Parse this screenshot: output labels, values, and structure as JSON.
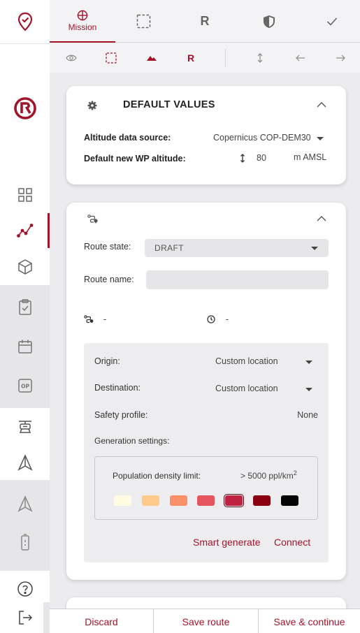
{
  "colors": {
    "accent": "#a3142a",
    "panel": "#ededef",
    "rail_gray": "#e6e6e8"
  },
  "rail": {
    "items": [
      {
        "icon": "location-check-icon"
      },
      {
        "icon": "brand-logo-icon"
      },
      {
        "icon": "grid-icon"
      },
      {
        "icon": "route-icon",
        "active": true
      },
      {
        "icon": "cube-icon"
      },
      {
        "icon": "clipboard-check-icon"
      },
      {
        "icon": "calendar-icon"
      },
      {
        "icon": "op-badge-icon"
      },
      {
        "icon": "drone-icon"
      },
      {
        "icon": "navigation-icon"
      },
      {
        "icon": "navigation-icon"
      },
      {
        "icon": "battery-icon"
      },
      {
        "icon": "help-icon"
      },
      {
        "icon": "logout-icon"
      }
    ]
  },
  "tabs": {
    "mission_label": "Mission",
    "mission_icon": "crosshair-icon",
    "area_icon": "dashed-square-icon",
    "r_glyph": "R",
    "shield_icon": "shield-icon",
    "check_icon": "check-icon"
  },
  "toolbar": {
    "r_glyph": "R",
    "icons": [
      "eye-icon",
      "dashed-square-icon",
      "terrain-icon",
      "r-icon",
      "vertical-arrows-icon",
      "arrow-left-icon",
      "arrow-right-icon"
    ]
  },
  "defaults": {
    "title": "DEFAULT VALUES",
    "altitude_source_label": "Altitude data source:",
    "altitude_source_value": "Copernicus COP-DEM30",
    "wp_altitude_label": "Default new WP altitude:",
    "wp_altitude_value": "80",
    "wp_altitude_unit": "m AMSL"
  },
  "route": {
    "state_label": "Route state:",
    "state_value": "DRAFT",
    "name_label": "Route name:",
    "name_value": "",
    "distance_value": "-",
    "duration_value": "-",
    "origin_label": "Origin:",
    "origin_value": "Custom location",
    "destination_label": "Destination:",
    "destination_value": "Custom location",
    "safety_label": "Safety profile:",
    "safety_value": "None",
    "generation_label": "Generation settings:",
    "density_label": "Population density limit:",
    "density_value": "> 5000 ppl/km",
    "density_sup": "2",
    "swatches": [
      "#fffbe2",
      "#fdca8c",
      "#fb8f68",
      "#e4555e",
      "#c02342",
      "#8b0013",
      "#050505"
    ],
    "selected_swatch": 4,
    "smart_generate_label": "Smart generate",
    "connect_label": "Connect"
  },
  "bottom": {
    "discard_label": "Discard",
    "save_label": "Save route",
    "save_continue_label": "Save & continue"
  }
}
